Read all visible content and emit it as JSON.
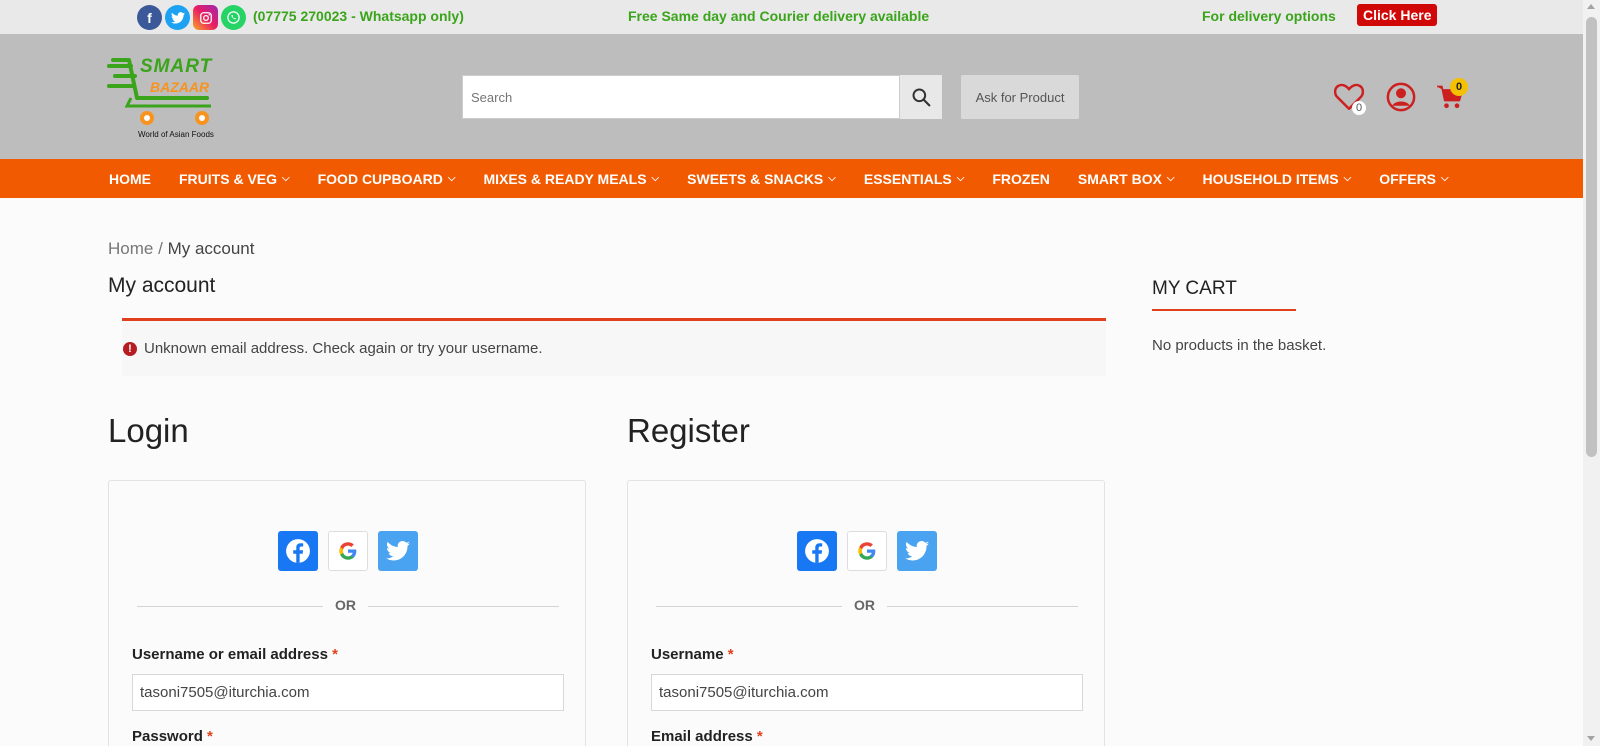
{
  "topbar": {
    "phone": "(07775 270023 - Whatsapp only)",
    "delivery_message": "Free Same day and Courier delivery available",
    "delivery_options": "For delivery options",
    "click_here": "Click Here",
    "social_icons": [
      "facebook-icon",
      "twitter-icon",
      "instagram-icon",
      "whatsapp-icon"
    ]
  },
  "header": {
    "logo_text_top": "SMART",
    "logo_text_bottom": "BAZAAR",
    "logo_tagline": "World of Asian Foods",
    "search_placeholder": "Search",
    "ask_button": "Ask for Product",
    "wishlist_count": "0",
    "cart_count": "0"
  },
  "nav": {
    "items": [
      {
        "label": "HOME",
        "dropdown": false
      },
      {
        "label": "FRUITS & VEG",
        "dropdown": true
      },
      {
        "label": "FOOD CUPBOARD",
        "dropdown": true
      },
      {
        "label": "MIXES & READY MEALS",
        "dropdown": true
      },
      {
        "label": "SWEETS & SNACKS",
        "dropdown": true
      },
      {
        "label": "ESSENTIALS",
        "dropdown": true
      },
      {
        "label": "FROZEN",
        "dropdown": false
      },
      {
        "label": "SMART BOX",
        "dropdown": true
      },
      {
        "label": "HOUSEHOLD ITEMS",
        "dropdown": true
      },
      {
        "label": "OFFERS",
        "dropdown": true
      }
    ]
  },
  "breadcrumb": {
    "home": "Home",
    "separator": "/",
    "current": "My account"
  },
  "page_title": "My account",
  "error": {
    "message": "Unknown email address. Check again or try your username."
  },
  "login": {
    "title": "Login",
    "or_text": "OR",
    "username_label": "Username or email address",
    "username_value": "tasoni7505@iturchia.com",
    "password_label": "Password",
    "required_mark": "*"
  },
  "register": {
    "title": "Register",
    "or_text": "OR",
    "username_label": "Username",
    "username_value": "tasoni7505@iturchia.com",
    "email_label": "Email address",
    "required_mark": "*"
  },
  "sidebar": {
    "title": "MY CART",
    "empty_text": "No products in the basket."
  },
  "colors": {
    "nav_bg": "#f15a00",
    "accent_red": "#e2401c",
    "green_text": "#3aa41b",
    "header_bg": "#bdbdbd"
  }
}
